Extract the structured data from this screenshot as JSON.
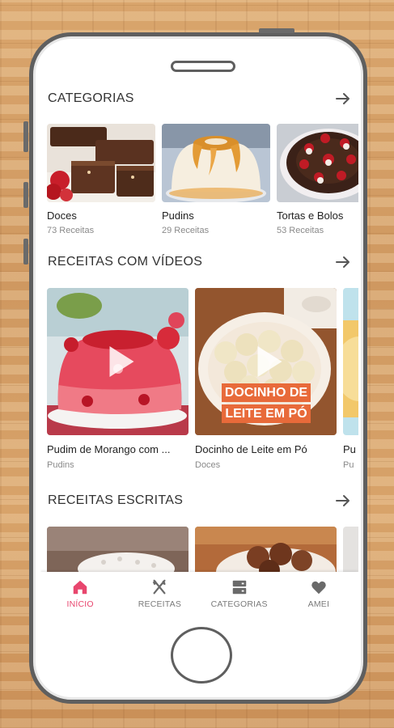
{
  "sections": {
    "categorias": {
      "title": "CATEGORIAS",
      "items": [
        {
          "name": "Doces",
          "count": "73 Receitas",
          "image": "brownie-photo"
        },
        {
          "name": "Pudins",
          "count": "29 Receitas",
          "image": "pudding-photo"
        },
        {
          "name": "Tortas e Bolos",
          "count": "53 Receitas",
          "image": "chocolate-cake-photo"
        }
      ]
    },
    "videos": {
      "title": "RECEITAS COM VÍDEOS",
      "items": [
        {
          "title": "Pudim de Morango com ...",
          "category": "Pudins"
        },
        {
          "title": "Docinho de Leite em Pó",
          "category": "Doces",
          "overlay_lines": [
            "DOCINHO DE",
            "LEITE EM PÓ"
          ]
        },
        {
          "title": "Pu",
          "category": "Pu"
        }
      ]
    },
    "escritas": {
      "title": "RECEITAS ESCRITAS"
    }
  },
  "tabbar": {
    "active": "inicio",
    "accent_color": "#e8466e",
    "tabs": [
      {
        "id": "inicio",
        "label": "INÍCIO",
        "icon": "home-icon"
      },
      {
        "id": "receitas",
        "label": "RECEITAS",
        "icon": "fork-knife-icon"
      },
      {
        "id": "categorias",
        "label": "CATEGORIAS",
        "icon": "categories-icon"
      },
      {
        "id": "amei",
        "label": "AMEI",
        "icon": "heart-icon"
      }
    ]
  }
}
